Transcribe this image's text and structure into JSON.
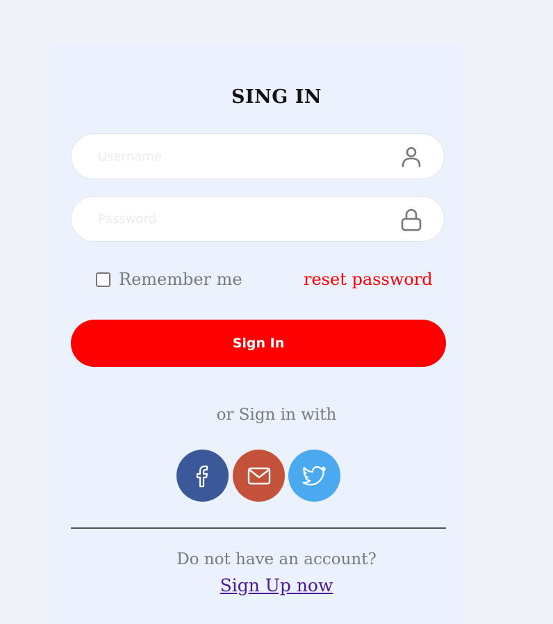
{
  "form": {
    "title": "SING IN",
    "username": {
      "placeholder": "Username",
      "value": "",
      "icon": "user-icon"
    },
    "password": {
      "placeholder": "Password",
      "value": "",
      "icon": "lock-icon"
    },
    "remember_label": "Remember me",
    "remember_checked": false,
    "reset_label": "reset password",
    "submit_label": "Sign In"
  },
  "social": {
    "heading": "or Sign in with",
    "buttons": [
      {
        "name": "facebook",
        "icon": "facebook-icon",
        "color": "#3b5998"
      },
      {
        "name": "email",
        "icon": "mail-icon",
        "color": "#c4513a"
      },
      {
        "name": "twitter",
        "icon": "twitter-icon",
        "color": "#4aa9ef"
      }
    ]
  },
  "footer": {
    "prompt": "Do not have an account?",
    "signup_label": "Sign Up now"
  },
  "colors": {
    "primary": "#ff0000",
    "card_bg": "#ebf2fd",
    "page_bg": "#eff3f9",
    "link": "#4b1a90"
  }
}
